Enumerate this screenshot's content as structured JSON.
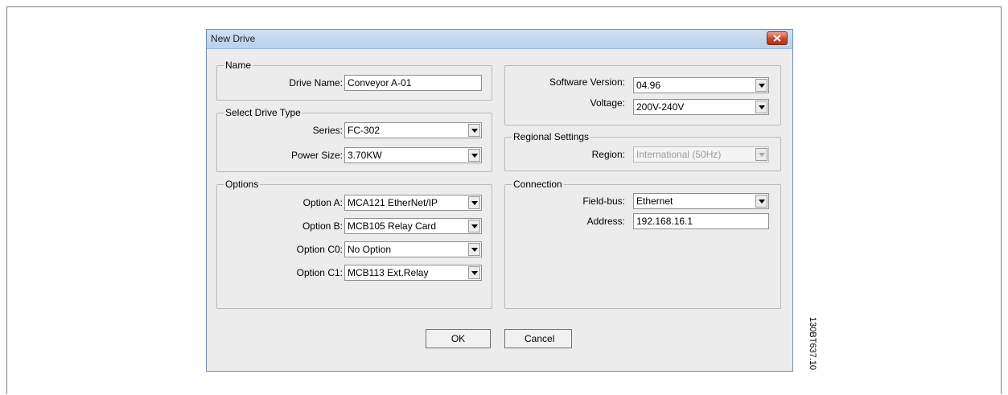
{
  "dialog": {
    "title": "New Drive"
  },
  "name_group": {
    "title": "Name",
    "drive_name_label": "Drive Name:",
    "drive_name_value": "Conveyor A-01"
  },
  "drive_type_group": {
    "title": "Select Drive Type",
    "series_label": "Series:",
    "series_value": "FC-302",
    "power_label": "Power Size:",
    "power_value": "3.70KW"
  },
  "options_group": {
    "title": "Options",
    "option_a_label": "Option A:",
    "option_a_value": "MCA121 EtherNet/IP",
    "option_b_label": "Option B:",
    "option_b_value": "MCB105 Relay Card",
    "option_c0_label": "Option C0:",
    "option_c0_value": "No Option",
    "option_c1_label": "Option C1:",
    "option_c1_value": "MCB113 Ext.Relay"
  },
  "version_group": {
    "software_label": "Software Version:",
    "software_value": "04.96",
    "voltage_label": "Voltage:",
    "voltage_value": "200V-240V"
  },
  "regional_group": {
    "title": "Regional Settings",
    "region_label": "Region:",
    "region_value": "International (50Hz)"
  },
  "connection_group": {
    "title": "Connection",
    "fieldbus_label": "Field-bus:",
    "fieldbus_value": "Ethernet",
    "address_label": "Address:",
    "address_value": "192.168.16.1"
  },
  "buttons": {
    "ok": "OK",
    "cancel": "Cancel"
  },
  "figure_code": "130BT637.10",
  "colors": {
    "dialog_bg": "#ececec",
    "titlebar": "#c4d8ee",
    "close": "#c9452a"
  },
  "icons": {
    "close": "close-icon",
    "dropdown": "chevron-down-icon"
  }
}
